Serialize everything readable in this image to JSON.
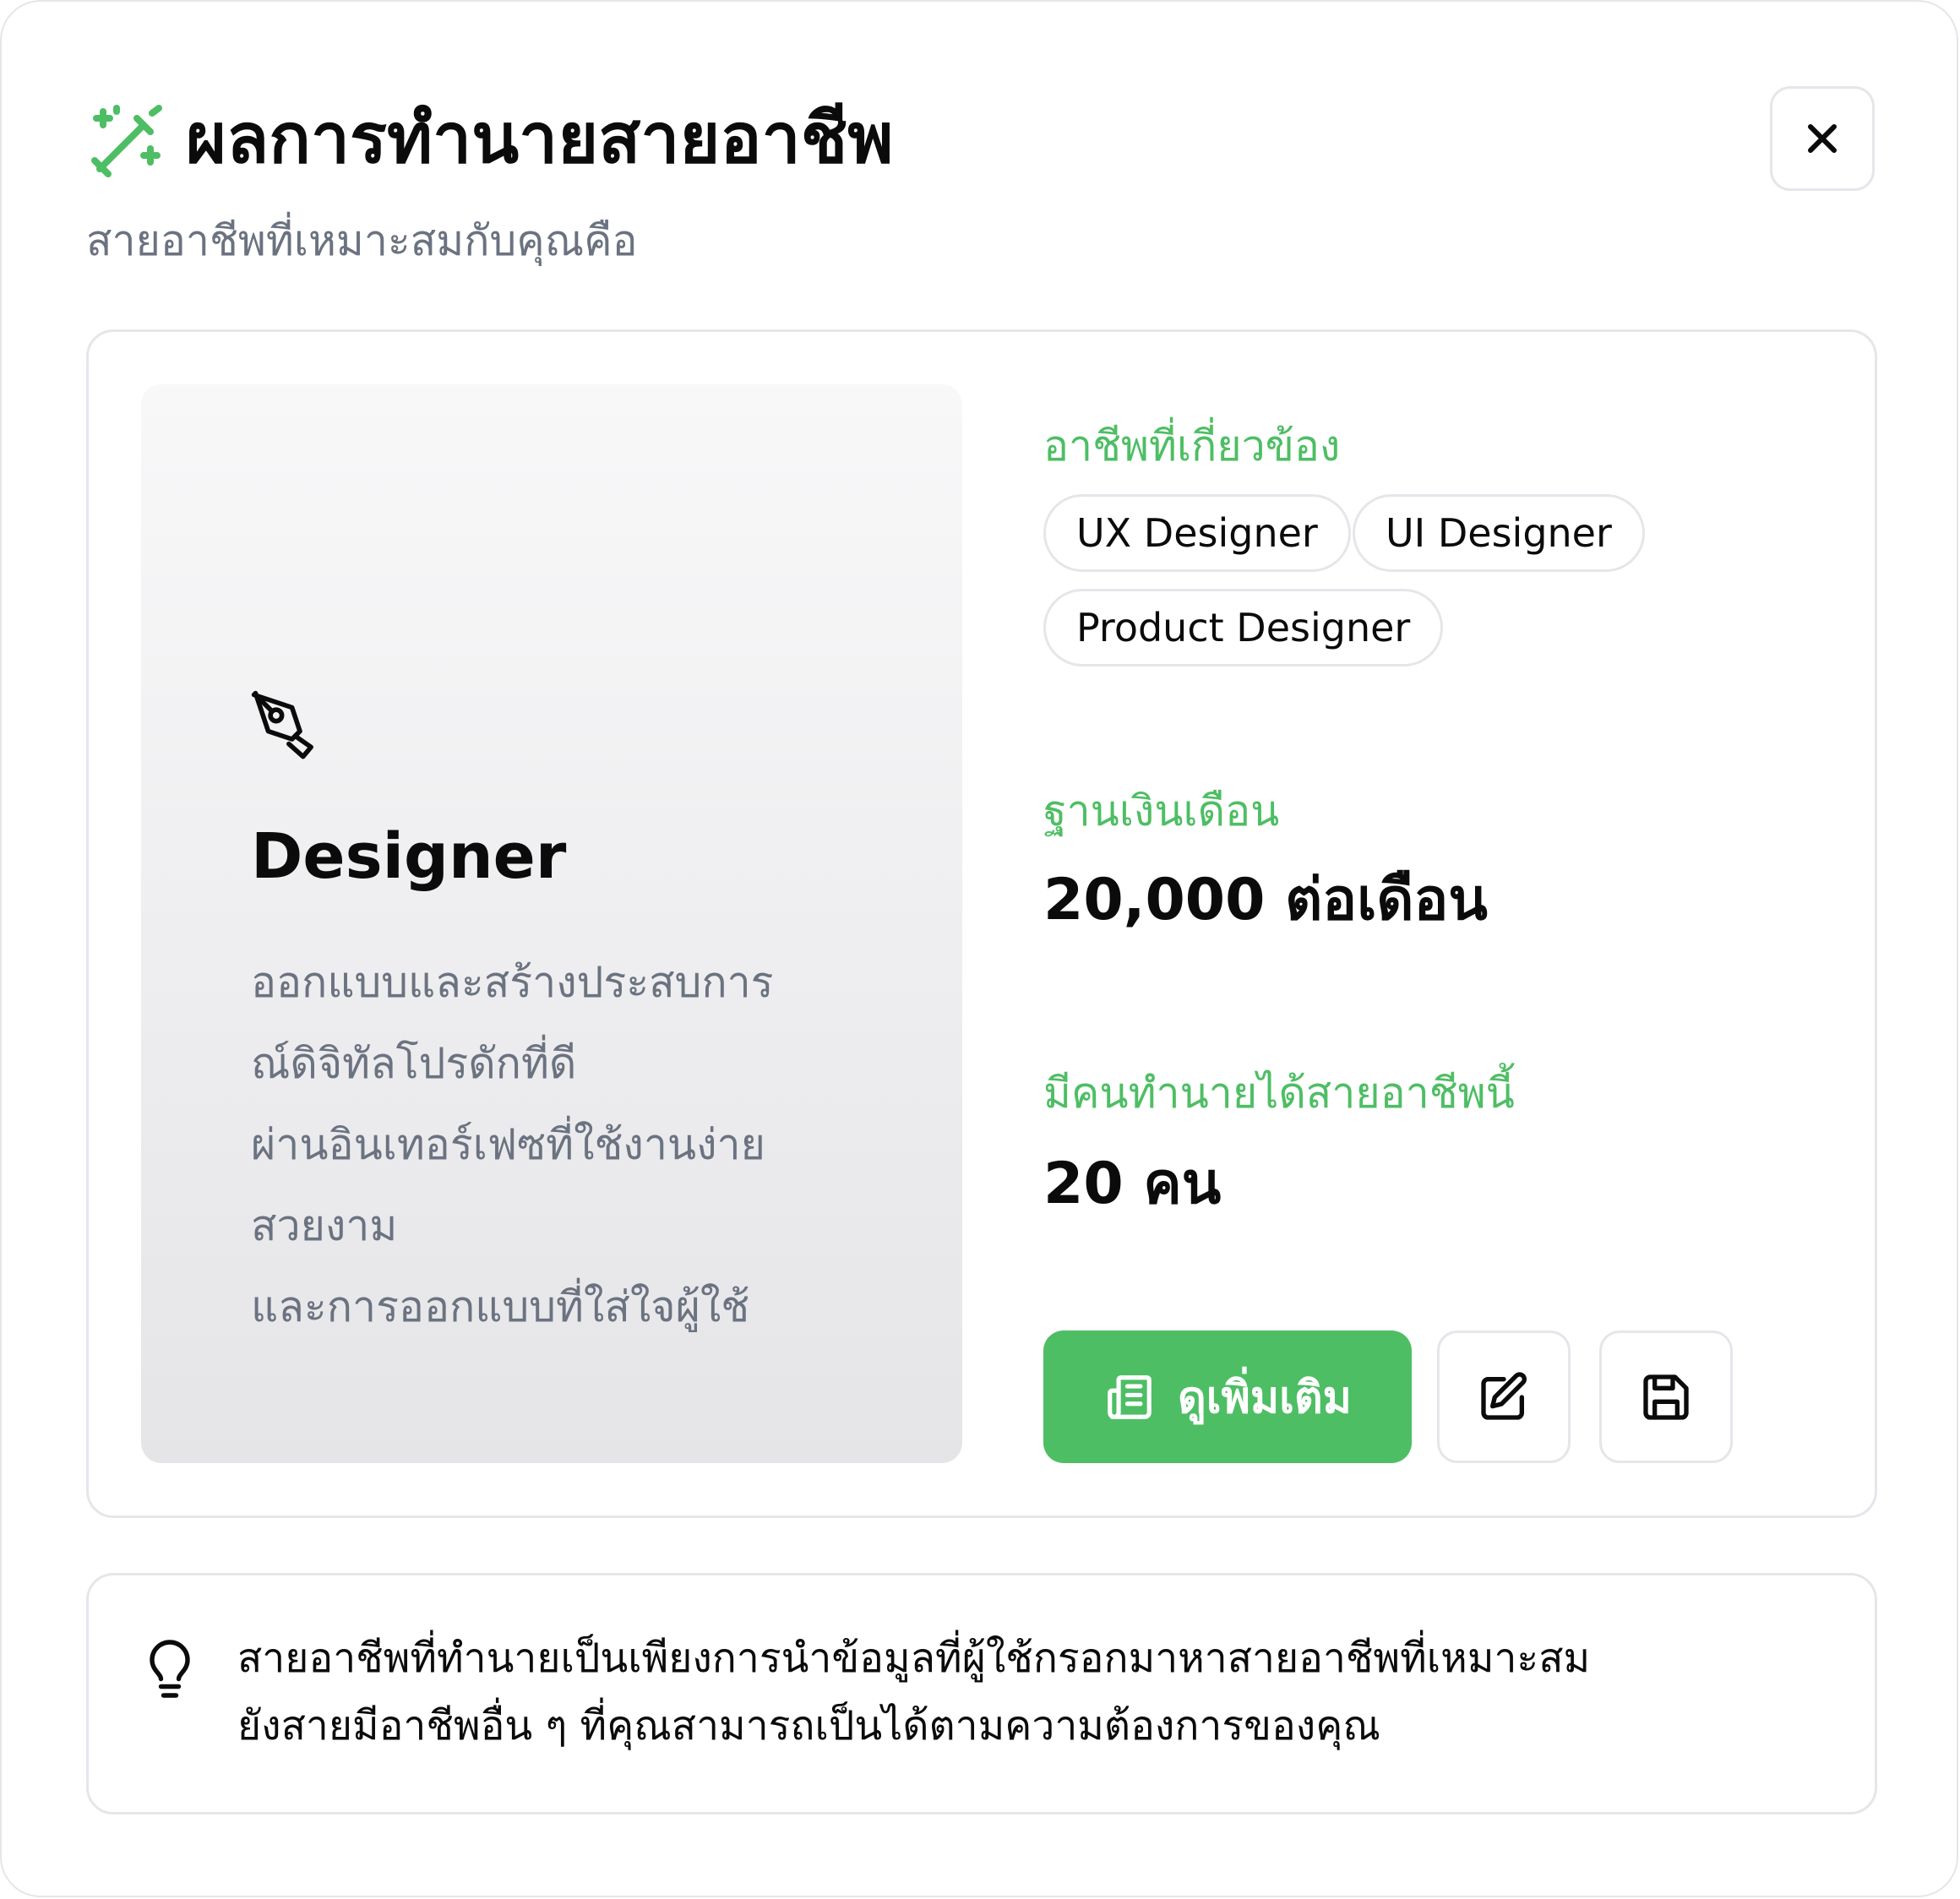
{
  "header": {
    "title": "ผลการทำนายสายอาชีพ",
    "subtitle": "สายอาชีพที่เหมาะสมกับคุณคือ",
    "title_icon": "magic-wand-icon",
    "close_icon": "close-icon"
  },
  "career": {
    "icon": "pen-tool-icon",
    "name": "Designer",
    "description_lines": [
      "ออกแบบและสร้างประสบการ",
      "ณ์ดิจิทัลโปรดักที่ดี",
      "ผ่านอินเทอร์เฟซที่ใช้งานง่าย",
      "สวยงาม",
      "และการออกแบบที่ใส่ใจผู้ใช้"
    ]
  },
  "related": {
    "label": "อาชีพที่เกี่ยวข้อง",
    "items": [
      "UX Designer",
      "UI Designer",
      "Product Designer"
    ]
  },
  "salary": {
    "label": "ฐานเงินเดือน",
    "value": "20,000 ต่อเดือน"
  },
  "predicted": {
    "label": "มีคนทำนายได้สายอาชีพนี้",
    "value": "20 คน"
  },
  "actions": {
    "more_label": "ดูเพิ่มเติม",
    "more_icon": "newspaper-icon",
    "edit_icon": "edit-icon",
    "save_icon": "save-icon"
  },
  "tip": {
    "icon": "lightbulb-icon",
    "lines": [
      "สายอาชีพที่ทำนายเป็นเพียงการนำข้อมูลที่ผู้ใช้กรอกมาหาสายอาชีพที่เหมาะสม",
      "ยังสายมีอาชีพอื่น ๆ ที่คุณสามารถเป็นได้ตามความต้องการของคุณ"
    ]
  },
  "colors": {
    "accent": "#4ebe64",
    "text": "#0b0b0b",
    "muted": "#6b7280",
    "border": "#e4e6ea"
  }
}
